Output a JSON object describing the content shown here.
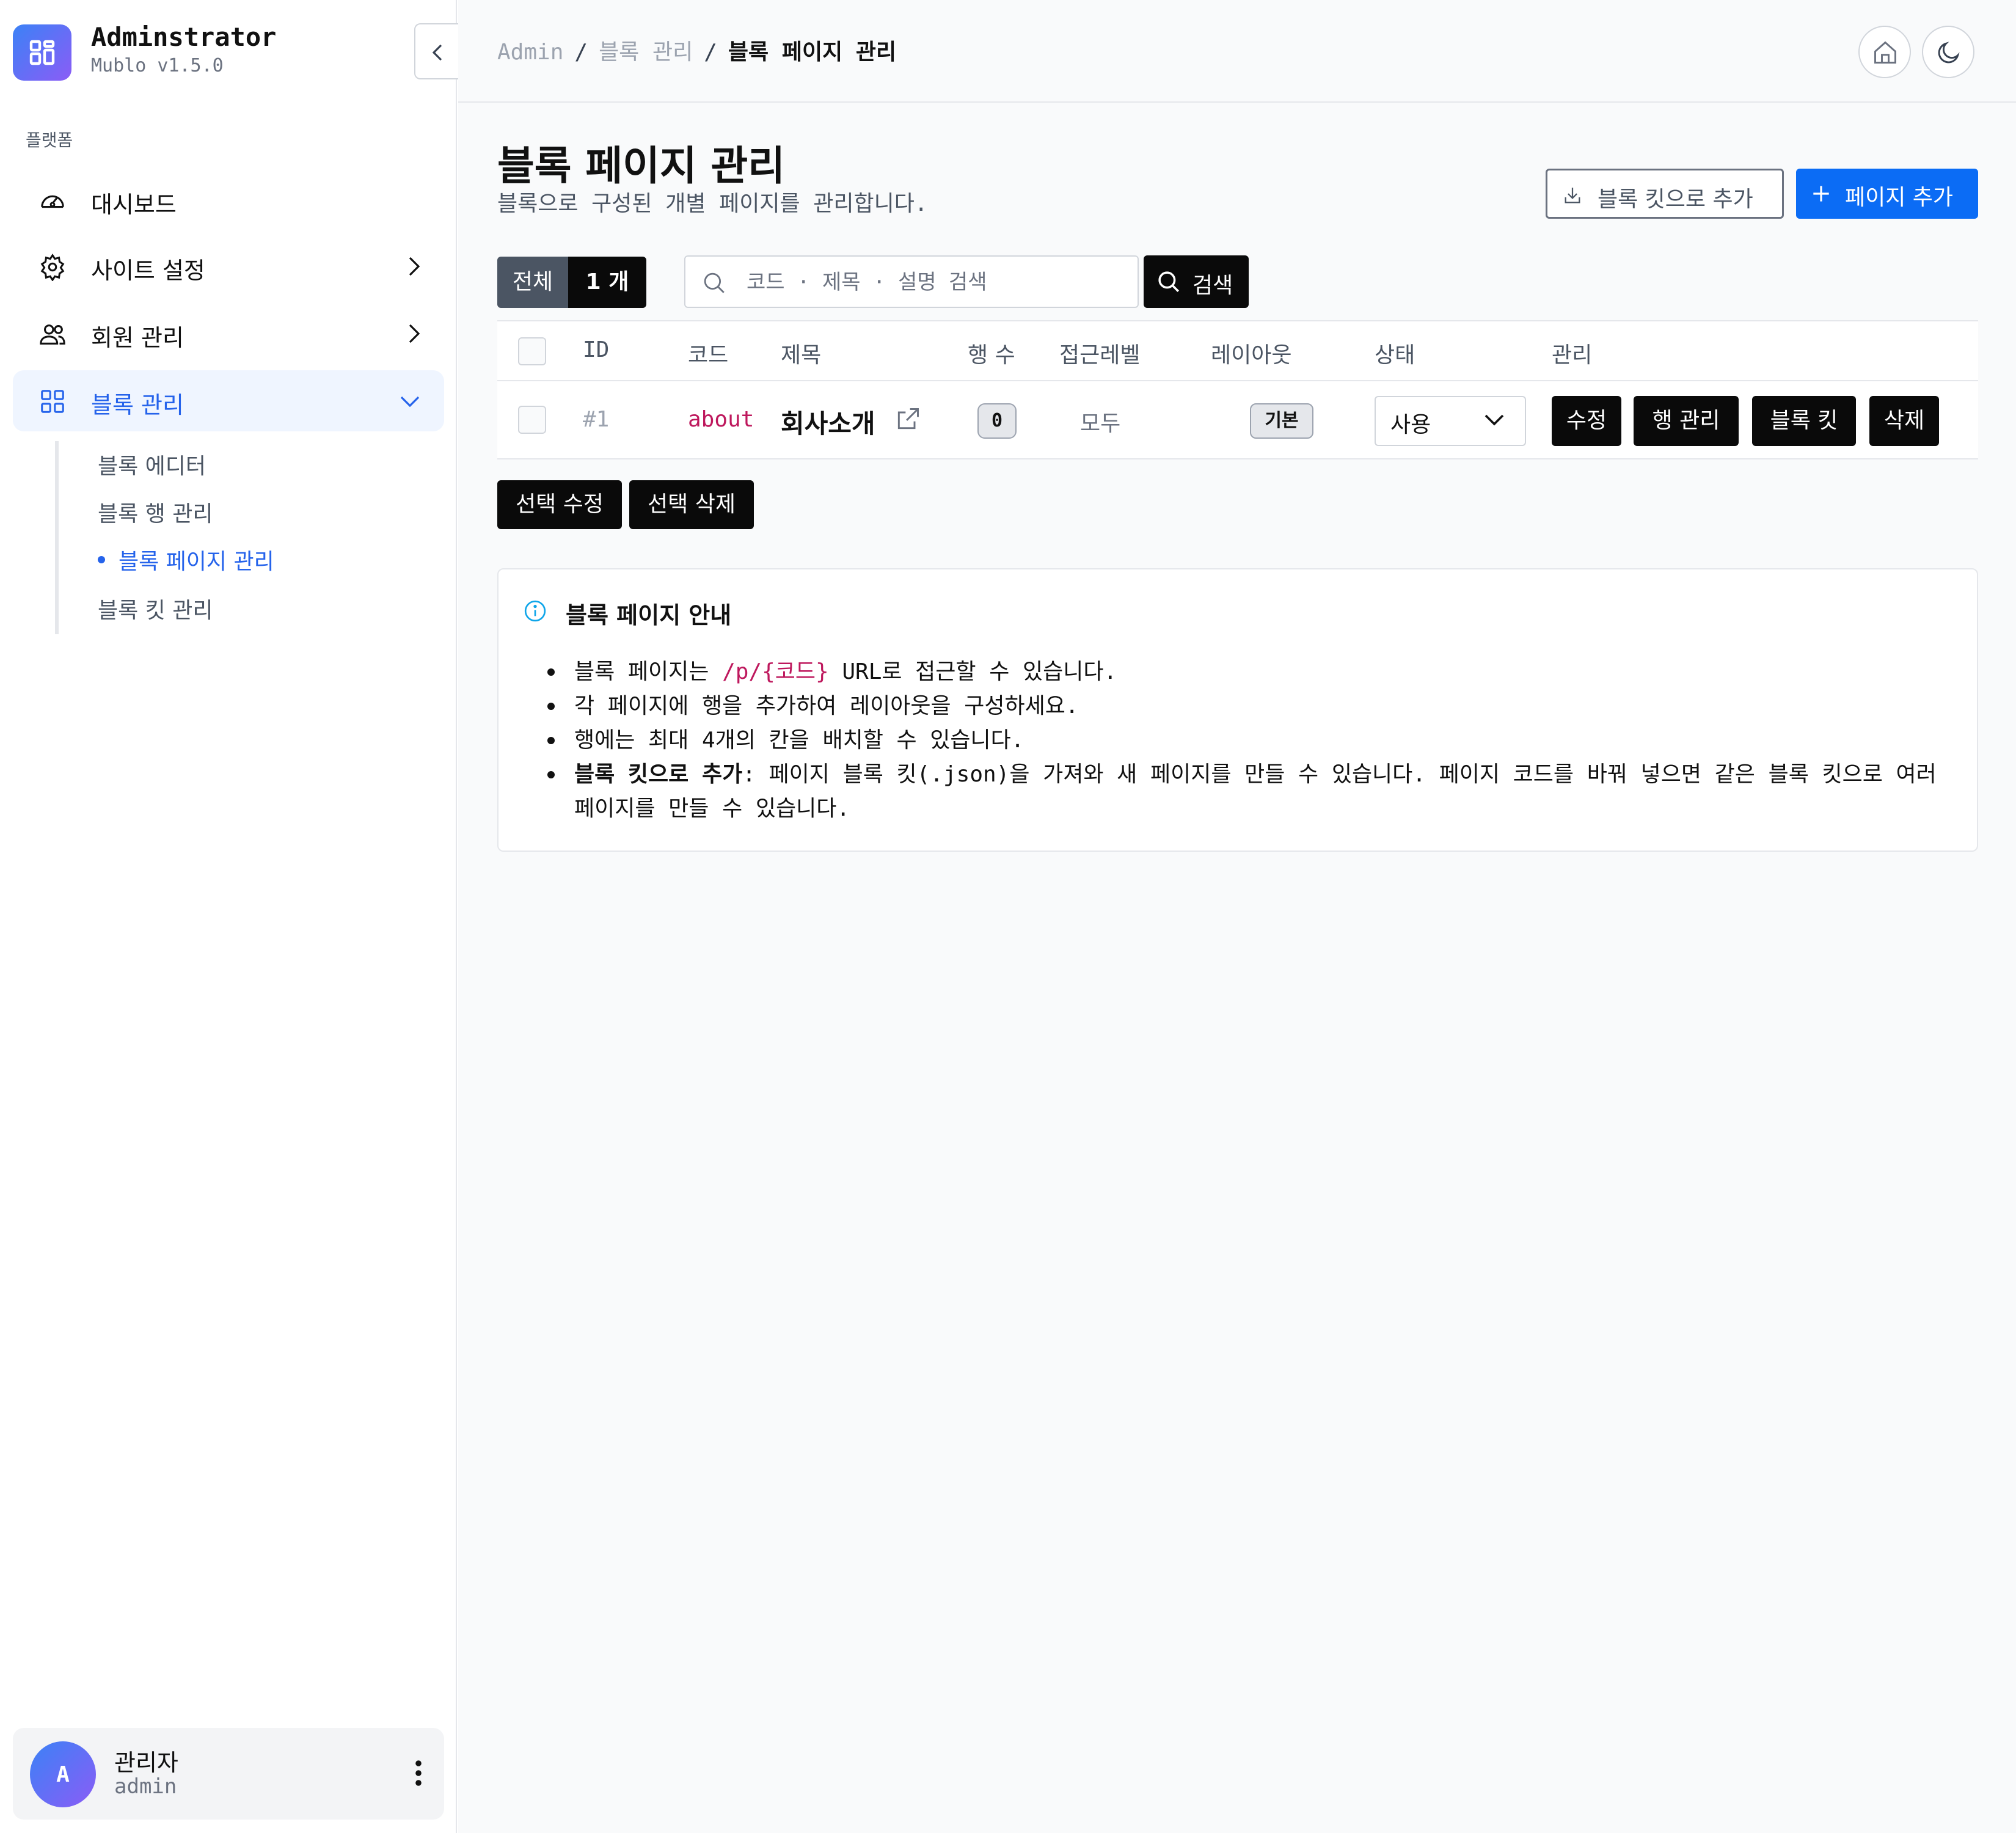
{
  "brand": {
    "name": "Adminstrator",
    "version": "Mublo v1.5.0"
  },
  "sidebar": {
    "section_label": "플랫폼",
    "items": [
      {
        "label": "대시보드",
        "icon": "gauge-icon"
      },
      {
        "label": "사이트 설정",
        "icon": "gear-icon"
      },
      {
        "label": "회원 관리",
        "icon": "users-icon"
      },
      {
        "label": "블록 관리",
        "icon": "grid-icon"
      }
    ],
    "subitems": [
      {
        "label": "블록 에디터"
      },
      {
        "label": "블록 행 관리"
      },
      {
        "label": "블록 페이지 관리"
      },
      {
        "label": "블록 킷 관리"
      }
    ]
  },
  "user": {
    "avatar_letter": "A",
    "name": "관리자",
    "id": "admin"
  },
  "breadcrumb": {
    "root": "Admin",
    "parent": "블록 관리",
    "current": "블록 페이지 관리",
    "sep": "/"
  },
  "page": {
    "title": "블록 페이지 관리",
    "subtitle": "블록으로 구성된 개별 페이지를 관리합니다.",
    "kit_add_label": "블록 킷으로 추가",
    "add_page_label": "페이지 추가"
  },
  "filter": {
    "count_label": "전체",
    "count_value": "1 개",
    "search_placeholder": "코드 · 제목 · 설명 검색",
    "search_button": "검색"
  },
  "table": {
    "headers": {
      "id": "ID",
      "code": "코드",
      "title": "제목",
      "rows": "행 수",
      "access": "접근레벨",
      "layout": "레이아웃",
      "status": "상태",
      "manage": "관리"
    },
    "rows": [
      {
        "id": "#1",
        "code": "about",
        "title": "회사소개",
        "row_count": "0",
        "access": "모두",
        "layout": "기본",
        "status": "사용",
        "actions": [
          "수정",
          "행 관리",
          "블록 킷",
          "삭제"
        ]
      }
    ]
  },
  "bulk": {
    "edit_label": "선택 수정",
    "delete_label": "선택 삭제"
  },
  "info": {
    "title": "블록 페이지 안내",
    "item1_pre": "블록 페이지는 ",
    "item1_code": "/p/{코드}",
    "item1_post": " URL로 접근할 수 있습니다.",
    "item2": "각 페이지에 행을 추가하여 레이아웃을 구성하세요.",
    "item3": "행에는 최대 4개의 칸을 배치할 수 있습니다.",
    "item4_strong": "블록 킷으로 추가",
    "item4_rest": ": 페이지 블록 킷(.json)을 가져와 새 페이지를 만들 수 있습니다. 페이지 코드를 바꿔 넣으면 같은 블록 킷으로 여러 페이지를 만들 수 있습니다."
  },
  "colors": {
    "accent": "#0b6cf5",
    "active_nav": "#2563eb",
    "code": "#be185d"
  }
}
